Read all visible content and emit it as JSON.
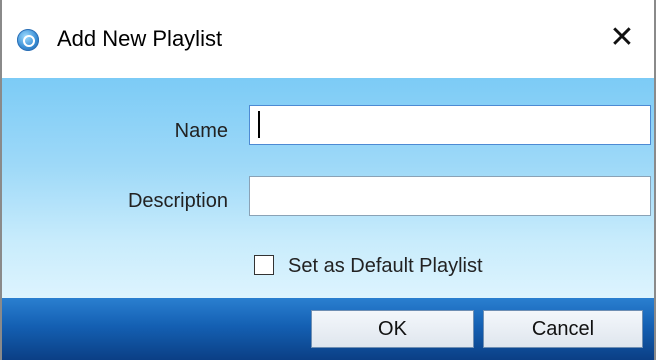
{
  "window": {
    "title": "Add New Playlist",
    "close_glyph": "✕",
    "app_icon": "app-logo-icon"
  },
  "form": {
    "name_label": "Name",
    "name_value": "",
    "description_label": "Description",
    "description_value": "",
    "default_checkbox_label": "Set as Default Playlist",
    "default_checked": false
  },
  "buttons": {
    "ok_label": "OK",
    "cancel_label": "Cancel"
  },
  "colors": {
    "content_gradient_top": "#7ccbf6",
    "content_gradient_bottom": "#ddf4fe",
    "button_bar_top": "#2a7fd0",
    "button_bar_bottom": "#0b3f85"
  }
}
